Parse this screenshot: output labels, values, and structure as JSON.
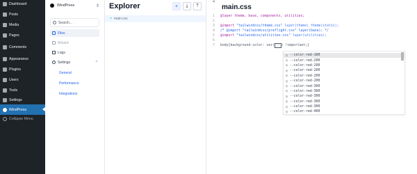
{
  "wp_menu": {
    "items": [
      {
        "label": "Dashboard",
        "icon": "dashboard-icon"
      },
      {
        "label": "Posts",
        "icon": "pin-icon"
      },
      {
        "label": "Media",
        "icon": "media-icon"
      },
      {
        "label": "Pages",
        "icon": "page-icon"
      },
      {
        "label": "Comments",
        "icon": "comment-icon"
      },
      {
        "label": "Appearance",
        "icon": "brush-icon"
      },
      {
        "label": "Plugins",
        "icon": "plug-icon"
      },
      {
        "label": "Users",
        "icon": "users-icon"
      },
      {
        "label": "Tools",
        "icon": "wrench-icon"
      },
      {
        "label": "Settings",
        "icon": "settings-icon"
      }
    ],
    "active_item": {
      "label": "WindPress",
      "icon": "windpress-icon"
    },
    "collapse": {
      "label": "Collapse Menu",
      "icon": "collapse-icon"
    }
  },
  "plugin": {
    "brand": "WindPress",
    "search_label": "Search...",
    "nav": {
      "files": "Files",
      "wizard": "Wizard",
      "logs": "Logs",
      "settings": "Settings",
      "sub": [
        "General",
        "Performance",
        "Integrations"
      ]
    }
  },
  "explorer": {
    "title": "Explorer",
    "add": "+",
    "download": "⤓",
    "upload": "⤒",
    "file": "main.css"
  },
  "editor": {
    "back": "<",
    "title": "main.css",
    "lines": [
      {
        "n": "1",
        "parts": [
          {
            "t": "@layer theme, base, components, utilities;",
            "c": "kw"
          }
        ]
      },
      {
        "n": "2",
        "parts": [
          {
            "t": "",
            "c": "txt"
          }
        ]
      },
      {
        "n": "3",
        "parts": [
          {
            "t": "@import ",
            "c": "kw"
          },
          {
            "t": "\"tailwindcss/theme.css\" ",
            "c": "str"
          },
          {
            "t": "layer(theme) theme(static);",
            "c": "fn"
          }
        ]
      },
      {
        "n": "4",
        "parts": [
          {
            "t": "/* @import \"tailwindcss/preflight.css\" layer(base); */",
            "c": "cm"
          }
        ]
      },
      {
        "n": "5",
        "parts": [
          {
            "t": "@import ",
            "c": "kw"
          },
          {
            "t": "\"tailwindcss/utilities.css\" ",
            "c": "str"
          },
          {
            "t": "layer(utilities);",
            "c": "fn"
          }
        ]
      },
      {
        "n": "6",
        "parts": [
          {
            "t": "",
            "c": "txt"
          }
        ]
      },
      {
        "n": "7",
        "parts": [
          {
            "t": "body{background-color: var(",
            "c": "txt"
          },
          {
            "t": "--",
            "c": "caret"
          },
          {
            "t": ") !important;}",
            "c": "txt"
          }
        ]
      }
    ],
    "autocomplete": [
      "--color-red-100",
      "--color-red-200",
      "--color-red-200",
      "--color-red-200",
      "--color-red-200",
      "--color-red-200",
      "--color-red-300",
      "--color-red-300",
      "--color-red-300",
      "--color-red-300",
      "--color-red-300",
      "--color-red-400"
    ],
    "autocomplete_icon": "palette-icon"
  },
  "colors": {
    "wp_menu_bg": "#1d2327",
    "wp_active": "#2271b1",
    "accent": "#2563eb"
  }
}
